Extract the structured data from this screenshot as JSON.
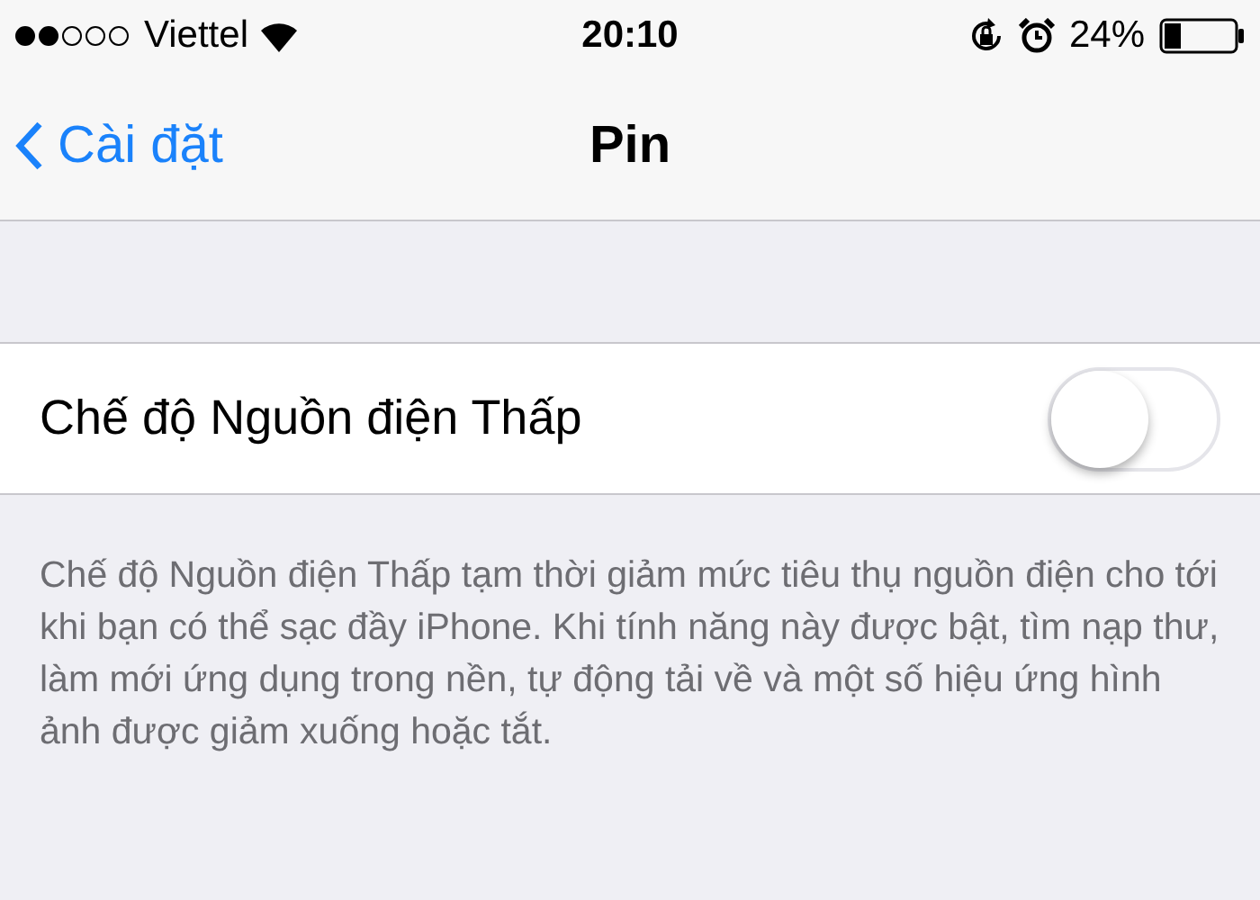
{
  "status_bar": {
    "carrier": "Viettel",
    "time": "20:10",
    "battery_percent": "24%"
  },
  "nav": {
    "back_label": "Cài đặt",
    "title": "Pin"
  },
  "setting": {
    "label": "Chế độ Nguồn điện Thấp",
    "on": false
  },
  "footer": "Chế độ Nguồn điện Thấp tạm thời giảm mức tiêu thụ nguồn điện cho tới khi bạn có thể sạc đầy iPhone. Khi tính năng này được bật, tìm nạp thư, làm mới ứng dụng trong nền, tự động tải về và một số hiệu ứng hình ảnh được giảm xuống hoặc tắt."
}
